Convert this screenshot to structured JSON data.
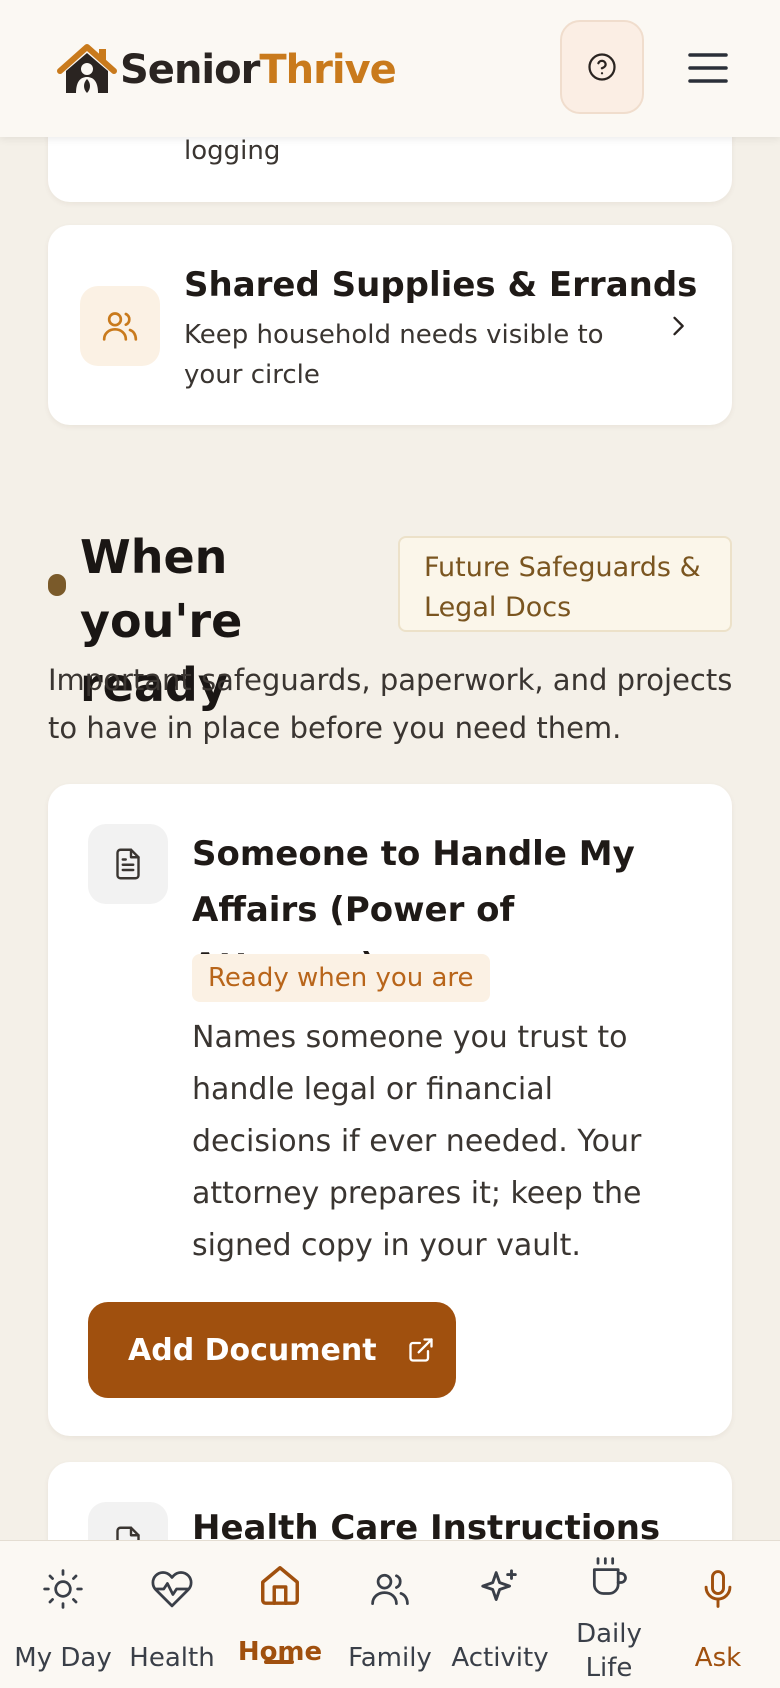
{
  "header": {
    "brand_part1": "Senior",
    "brand_part2": "Thrive",
    "help_icon": "question-circle-icon",
    "menu_icon": "hamburger-menu-icon"
  },
  "cards": {
    "top_partial_subtext": "logging",
    "supplies": {
      "title": "Shared Supplies & Errands",
      "description": "Keep household needs visible to your circle",
      "icon": "users-icon"
    }
  },
  "section": {
    "title": "When you're ready",
    "tag": "Future Safeguards & Legal Docs",
    "description": "Important safeguards, paperwork, and projects to have in place before you need them."
  },
  "poa_card": {
    "title": "Someone to Handle My Affairs (Power of Attorney)",
    "status": "Ready when you are",
    "description": "Names someone you trust to handle legal or financial decisions if ever needed. Your attorney prepares it; keep the signed copy in your vault.",
    "button_label": "Add Document",
    "icon": "document-icon"
  },
  "hci_card": {
    "title": "Health Care Instructions",
    "icon": "document-icon"
  },
  "nav": {
    "items": [
      {
        "label": "My Day",
        "icon": "sun-icon"
      },
      {
        "label": "Health",
        "icon": "heart-pulse-icon"
      },
      {
        "label": "Home",
        "icon": "home-icon",
        "active": true
      },
      {
        "label": "Family",
        "icon": "users-icon"
      },
      {
        "label": "Activity",
        "icon": "sparkles-icon"
      },
      {
        "label": "Daily Life",
        "icon": "coffee-cup-icon"
      },
      {
        "label": "Ask",
        "icon": "microphone-icon"
      }
    ]
  },
  "colors": {
    "background": "#f4f0e8",
    "accent": "#a0500e",
    "brand_orange": "#c97a1c"
  }
}
